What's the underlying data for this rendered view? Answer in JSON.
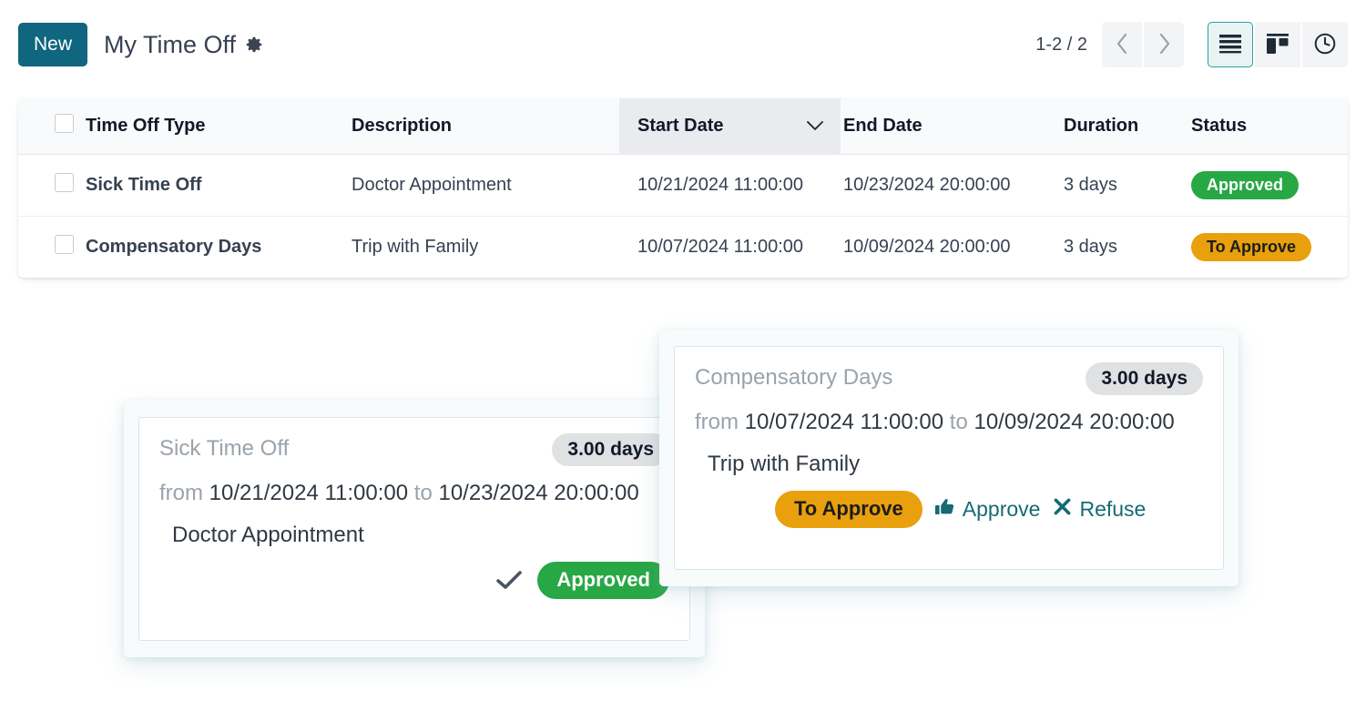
{
  "control_panel": {
    "new_button": "New",
    "breadcrumb": "My Time Off",
    "gear_icon": "gear-icon",
    "pager": "1-2 / 2",
    "prev_icon": "chevron-left-icon",
    "next_icon": "chevron-right-icon",
    "views": [
      {
        "name": "list",
        "icon": "list-view-icon",
        "active": true
      },
      {
        "name": "kanban",
        "icon": "kanban-view-icon",
        "active": false
      },
      {
        "name": "activity",
        "icon": "clock-view-icon",
        "active": false
      }
    ]
  },
  "list_view": {
    "columns": [
      {
        "key": "type",
        "label": "Time Off Type",
        "sorted": false
      },
      {
        "key": "description",
        "label": "Description",
        "sorted": false
      },
      {
        "key": "start_date",
        "label": "Start Date",
        "sorted": true,
        "sort_icon": "chevron-down-icon"
      },
      {
        "key": "end_date",
        "label": "End Date",
        "sorted": false
      },
      {
        "key": "duration",
        "label": "Duration",
        "sorted": false
      },
      {
        "key": "status",
        "label": "Status",
        "sorted": false
      }
    ],
    "rows": [
      {
        "type": "Sick Time Off",
        "description": "Doctor Appointment",
        "start_date": "10/21/2024 11:00:00",
        "end_date": "10/23/2024 20:00:00",
        "duration": "3 days",
        "status": "Approved",
        "status_style": "approved"
      },
      {
        "type": "Compensatory Days",
        "description": "Trip with Family",
        "start_date": "10/07/2024 11:00:00",
        "end_date": "10/09/2024 20:00:00",
        "duration": "3 days",
        "status": "To Approve",
        "status_style": "to_approve"
      }
    ]
  },
  "popovers": {
    "left": {
      "title": "Sick Time Off",
      "days_badge": "3.00 days",
      "from_label": "from",
      "start": "10/21/2024 11:00:00",
      "to_label": "to",
      "end": "10/23/2024 20:00:00",
      "description": "Doctor Appointment",
      "check_icon": "check-icon",
      "status": "Approved"
    },
    "right": {
      "title": "Compensatory Days",
      "days_badge": "3.00 days",
      "from_label": "from",
      "start": "10/07/2024 11:00:00",
      "to_label": "to",
      "end": "10/09/2024 20:00:00",
      "description": "Trip with Family",
      "status": "To Approve",
      "approve_label": "Approve",
      "approve_icon": "thumbs-up-icon",
      "refuse_label": "Refuse",
      "refuse_icon": "x-icon"
    }
  },
  "colors": {
    "primary": "#10657f",
    "accent_teal": "#156a73",
    "approved_green": "#28a745",
    "to_approve_amber": "#e8a00d",
    "active_view_border": "#2f9e9e"
  }
}
